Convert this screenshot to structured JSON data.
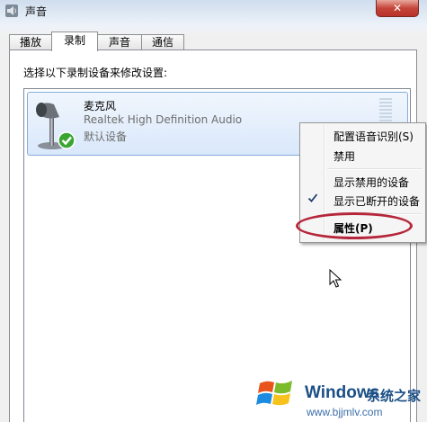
{
  "window": {
    "title": "声音",
    "close_label": "✕"
  },
  "tabs": [
    {
      "label": "播放",
      "active": false
    },
    {
      "label": "录制",
      "active": true
    },
    {
      "label": "声音",
      "active": false
    },
    {
      "label": "通信",
      "active": false
    }
  ],
  "panel": {
    "instruction": "选择以下录制设备来修改设置:"
  },
  "device": {
    "name": "麦克风",
    "driver": "Realtek High Definition Audio",
    "status": "默认设备",
    "icon": "microphone-icon",
    "badge": "default-check-badge"
  },
  "context_menu": {
    "items": [
      {
        "label": "配置语音识别(S)",
        "checked": false,
        "bold": false
      },
      {
        "label": "禁用",
        "checked": false,
        "bold": false
      },
      {
        "label": "显示禁用的设备",
        "checked": false,
        "bold": false
      },
      {
        "label": "显示已断开的设备",
        "checked": true,
        "bold": false
      },
      {
        "label": "属性(P)",
        "checked": false,
        "bold": true
      }
    ],
    "highlight_color": "#b5263a"
  },
  "watermark": {
    "brand": "Windows",
    "site": "系统之家",
    "url": "www.bjjmlv.com"
  }
}
